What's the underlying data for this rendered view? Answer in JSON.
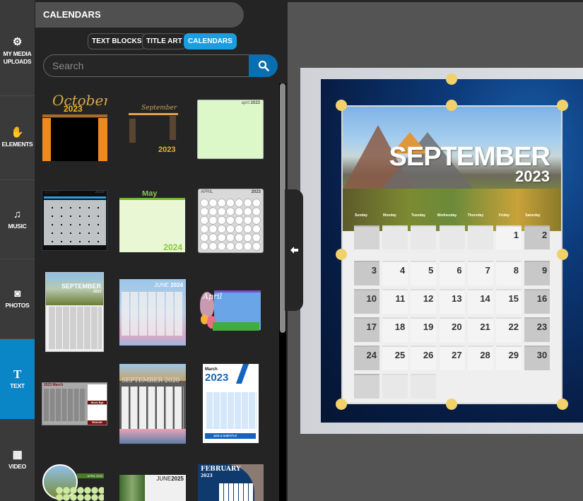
{
  "rail": {
    "items": [
      {
        "label": "MY MEDIA UPLOADS",
        "icon": "gears-icon",
        "active": false
      },
      {
        "label": "ELEMENTS",
        "icon": "hand-sparkle-icon",
        "active": false
      },
      {
        "label": "MUSIC",
        "icon": "music-note-icon",
        "active": false
      },
      {
        "label": "PHOTOS",
        "icon": "camera-icon",
        "active": false
      },
      {
        "label": "TEXT",
        "icon": "text-t-icon",
        "active": true
      },
      {
        "label": "VIDEO",
        "icon": "film-icon",
        "active": false
      }
    ]
  },
  "panel": {
    "title": "CALENDARS",
    "tabs": [
      {
        "label": "TEXT BLOCKS",
        "active": false
      },
      {
        "label": "TITLE ART",
        "active": false
      },
      {
        "label": "CALENDARS",
        "active": true
      }
    ],
    "search": {
      "placeholder": "Search",
      "value": ""
    },
    "thumbnails": [
      {
        "name": "october-2023",
        "title": "October",
        "year": "2023"
      },
      {
        "name": "september-2023-dark",
        "title": "September",
        "year": "2023"
      },
      {
        "name": "april-2023-green",
        "title": "april",
        "year": "2023"
      },
      {
        "name": "august-2024",
        "title": "AUGUST",
        "year": "2024"
      },
      {
        "name": "may-2024",
        "title": "May",
        "year": "2024"
      },
      {
        "name": "april-2023-circles",
        "title": "APRIL",
        "year": "2023"
      },
      {
        "name": "september-2023-photo",
        "title": "SEPTEMBER",
        "year": "2023"
      },
      {
        "name": "june-2024",
        "title": "JUNE",
        "year": "2024"
      },
      {
        "name": "april-easter",
        "title": "April",
        "year": ""
      },
      {
        "name": "march-2023-sports",
        "title": "March",
        "year": "2023",
        "notes": [
          "Work Bpt",
          "Soccer"
        ]
      },
      {
        "name": "september-2020",
        "title": "SEPTEMBER",
        "year": "2020"
      },
      {
        "name": "march-2023-blue",
        "title": "March",
        "year": "2023",
        "subtitle": "ADD A SUBTITLE"
      },
      {
        "name": "april-2023-circle-photo",
        "title": "APRIL",
        "year": "2023"
      },
      {
        "name": "june-2025",
        "title": "JUNE",
        "year": "2025"
      },
      {
        "name": "february-2023",
        "title": "FEBRUARY",
        "year": "2023"
      }
    ]
  },
  "canvas": {
    "calendar": {
      "month": "SEPTEMBER",
      "year": "2023",
      "weekdays": [
        "Sunday",
        "Monday",
        "Tuesday",
        "Wednesday",
        "Thursday",
        "Friday",
        "Saturday"
      ],
      "first_weekday_index": 5,
      "days_in_month": 30,
      "rows": 6
    },
    "collapse_icon": "arrow-left-icon"
  },
  "colors": {
    "accent": "#1a9ee0",
    "rail_active": "#0a86c7",
    "handle": "#f2d16b"
  }
}
